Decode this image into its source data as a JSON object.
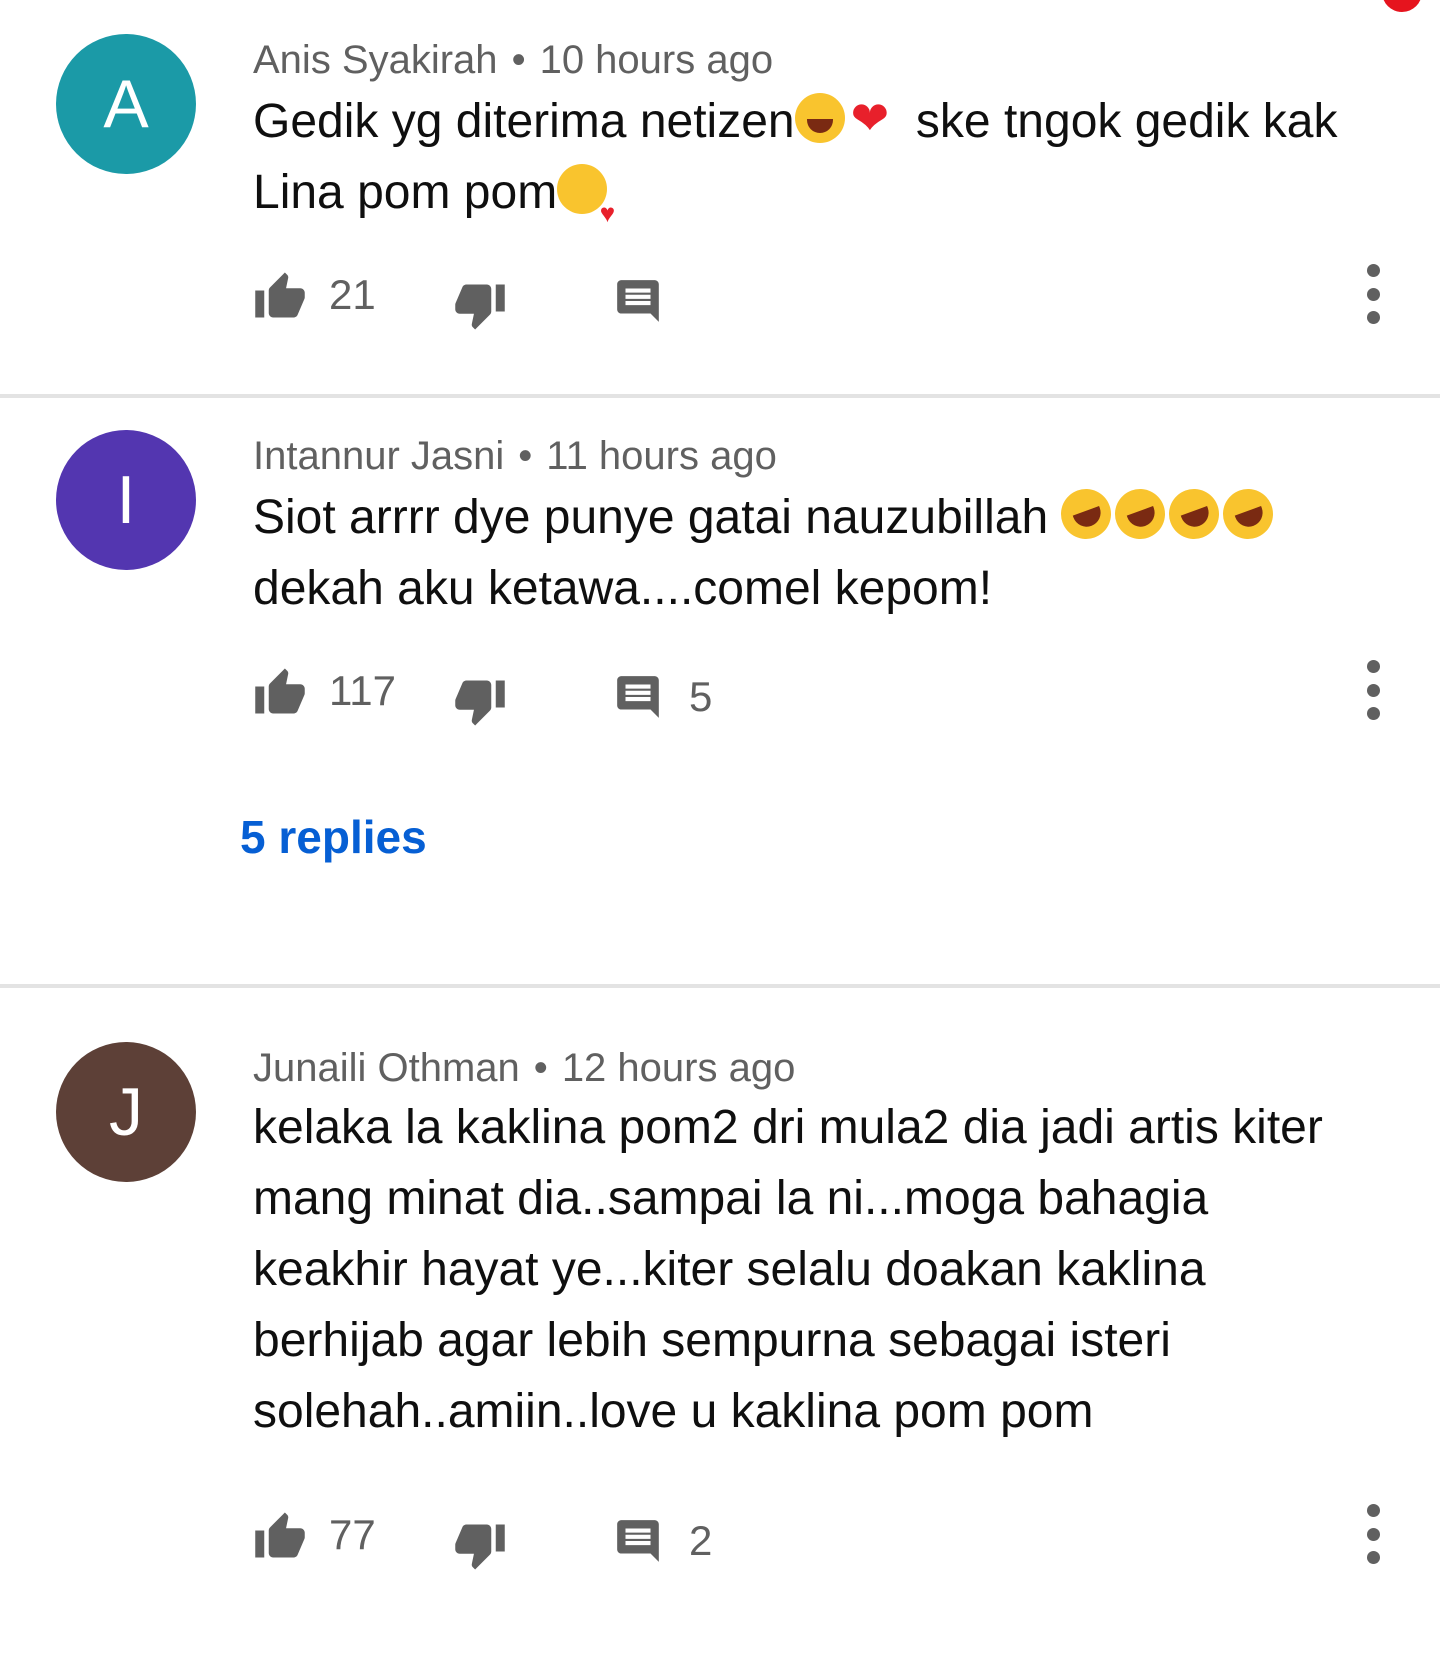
{
  "colors": {
    "avatar_a": "#1b9aa7",
    "avatar_i": "#5336b0",
    "avatar_j": "#5d4037",
    "link": "#065fd4",
    "meta": "#606060"
  },
  "comments": [
    {
      "avatar_letter": "A",
      "author": "Anis Syakirah",
      "time": "10 hours ago",
      "text_parts": [
        "Gedik yg diterima netizen",
        " ske tngok gedik kak Lina pom pom"
      ],
      "emojis": [
        "grinning-sweat-emoji",
        "red-heart-emoji",
        "face-blowing-kiss-emoji"
      ],
      "likes": "21",
      "replies_count": ""
    },
    {
      "avatar_letter": "I",
      "author": "Intannur Jasni",
      "time": "11 hours ago",
      "text_parts": [
        "Siot arrrr dye punye gatai nauzubillah ",
        "dekah aku ketawa....comel kepom!"
      ],
      "emojis": [
        "rofl-emoji",
        "rofl-emoji",
        "rofl-emoji",
        "rofl-emoji"
      ],
      "likes": "117",
      "replies_count": "5",
      "replies_link": "5 replies"
    },
    {
      "avatar_letter": "J",
      "author": "Junaili Othman",
      "time": "12 hours ago",
      "text": "kelaka la kaklina pom2 dri mula2 dia jadi artis kiter mang minat dia..sampai la ni...moga bahagia keakhir hayat ye...kiter selalu doakan kaklina berhijab agar lebih sempurna sebagai isteri solehah..amiin..love u kaklina pom pom",
      "likes": "77",
      "replies_count": "2"
    }
  ],
  "meta_separator": "•",
  "icons": [
    "thumb-up-icon",
    "thumb-down-icon",
    "reply-icon",
    "more-vert-icon"
  ]
}
